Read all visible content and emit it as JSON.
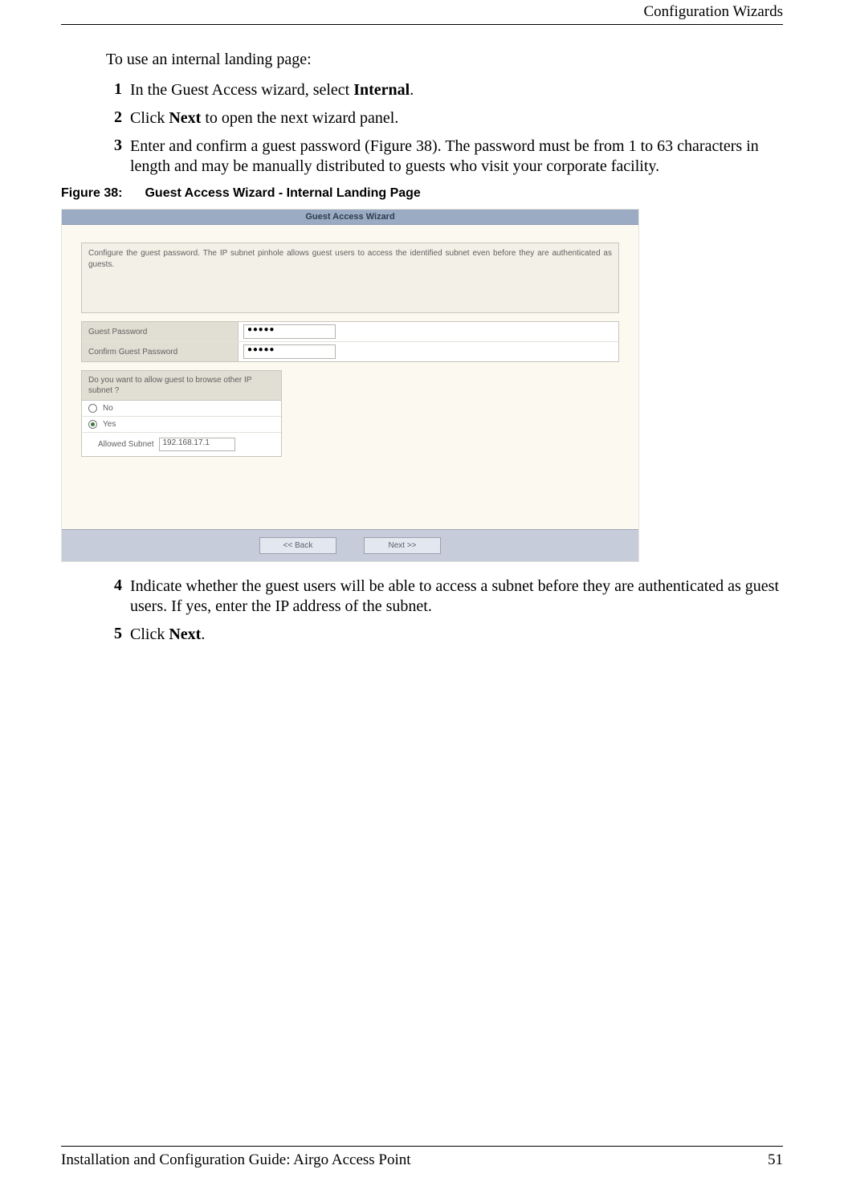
{
  "header": {
    "section": "Configuration Wizards"
  },
  "intro": "To use an internal landing page:",
  "steps_top": [
    {
      "num": "1",
      "html": "In the Guest Access wizard, select <b>Internal</b>."
    },
    {
      "num": "2",
      "html": "Click <b>Next</b> to open the next wizard panel."
    },
    {
      "num": "3",
      "html": "Enter and confirm a guest password (Figure 38). The password must be from 1 to 63 characters in length and may be manually distributed to guests who visit your corporate facility."
    }
  ],
  "figure": {
    "label": "Figure 38:",
    "title": "Guest Access Wizard - Internal Landing Page"
  },
  "wizard": {
    "title": "Guest Access Wizard",
    "description": "Configure the guest password. The IP subnet pinhole allows guest users to access the identified subnet even before they are authenticated as guests.",
    "guest_password_label": "Guest Password",
    "guest_password_value": "●●●●●",
    "confirm_password_label": "Confirm Guest Password",
    "confirm_password_value": "●●●●●",
    "subnet_question": "Do you want to allow guest to browse other IP subnet ?",
    "option_no": "No",
    "option_yes": "Yes",
    "allowed_subnet_label": "Allowed Subnet",
    "allowed_subnet_value": "192.168.17.1",
    "back_btn": "<< Back",
    "next_btn": "Next >>"
  },
  "steps_bottom": [
    {
      "num": "4",
      "html": "Indicate whether the guest users will be able to access a subnet before they are authenticated as guest users. If yes, enter the IP address of the subnet."
    },
    {
      "num": "5",
      "html": "Click <b>Next</b>."
    }
  ],
  "footer": {
    "doc": "Installation and Configuration Guide: Airgo Access Point",
    "page": "51"
  }
}
